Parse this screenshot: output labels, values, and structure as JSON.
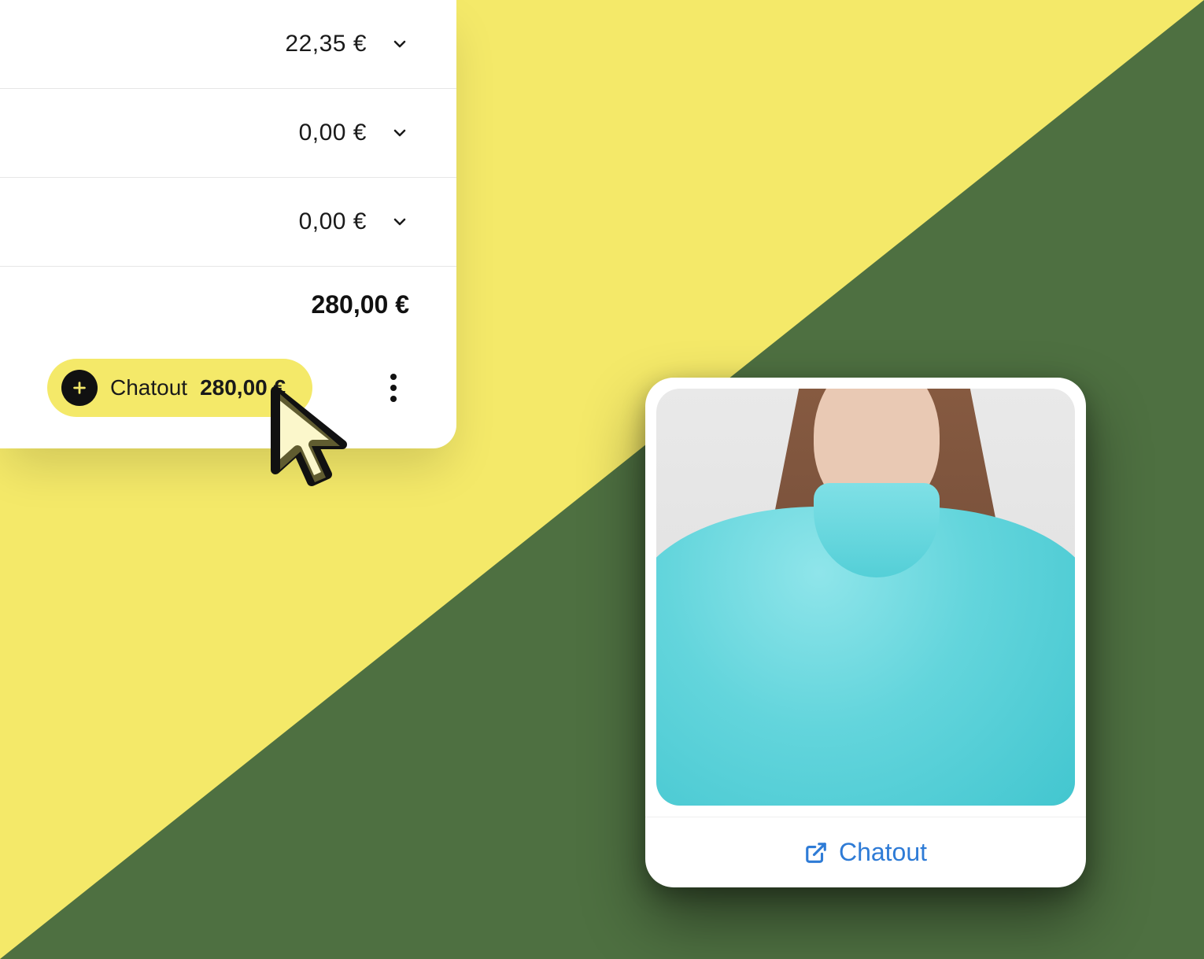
{
  "panel": {
    "rows": [
      {
        "amount": "22,35 €"
      },
      {
        "amount": "0,00 €"
      },
      {
        "amount": "0,00 €"
      }
    ],
    "total": "280,00 €",
    "chatout_label": "Chatout",
    "chatout_amount": "280,00 €"
  },
  "card": {
    "link_label": "Chatout"
  },
  "colors": {
    "yellow": "#f4e969",
    "green": "#4e7041",
    "link_blue": "#2e7bd6",
    "sweater": "#63d5dc"
  }
}
